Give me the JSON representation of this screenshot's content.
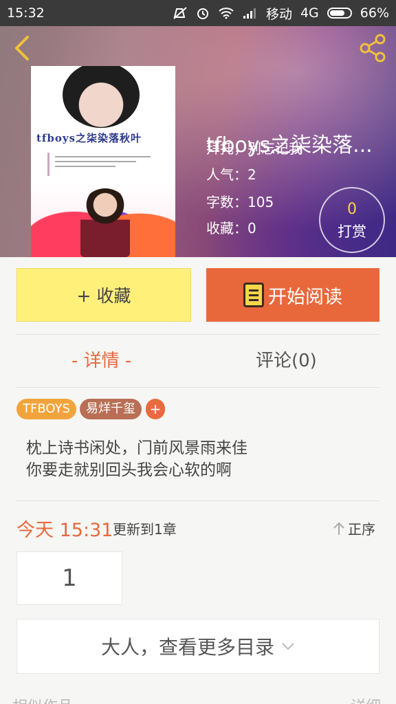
{
  "status_bar": {
    "time": "15:32",
    "carrier": "移动",
    "network": "4G",
    "battery": "66%"
  },
  "book": {
    "title": "tfboys之柒染落...",
    "subtitle": "拜托，别忘记我",
    "popularity": "人气：2",
    "word_count": "字数：105",
    "favorites": "收藏：0",
    "cover_title": "tfboys之柒染落秋叶"
  },
  "reward": {
    "count": "0",
    "label": "打赏"
  },
  "actions": {
    "collect_label": "+ 收藏",
    "read_label": "开始阅读"
  },
  "tabs": {
    "detail": "- 详情 -",
    "comments": "评论(0)"
  },
  "tags": [
    "TFBOYS",
    "易烊千玺",
    "+"
  ],
  "description": [
    "枕上诗书闲处，门前风景雨来佳",
    "你要走就别回头我会心软的啊"
  ],
  "update": {
    "date": "今天 15:31",
    "text": "更新到1章",
    "order_label": "正序"
  },
  "chapters": [
    "1"
  ],
  "toc_label": "大人，查看更多目录",
  "bottom": {
    "section_title": "相似作品",
    "more_label": "详细"
  },
  "colors": {
    "accent": "#e8683c",
    "collect_bg": "#fff07a",
    "reward_num": "#ffd24d"
  },
  "icons": [
    "back-icon",
    "share-icon",
    "book-icon",
    "arrow-up-icon",
    "chevron-down-icon"
  ]
}
